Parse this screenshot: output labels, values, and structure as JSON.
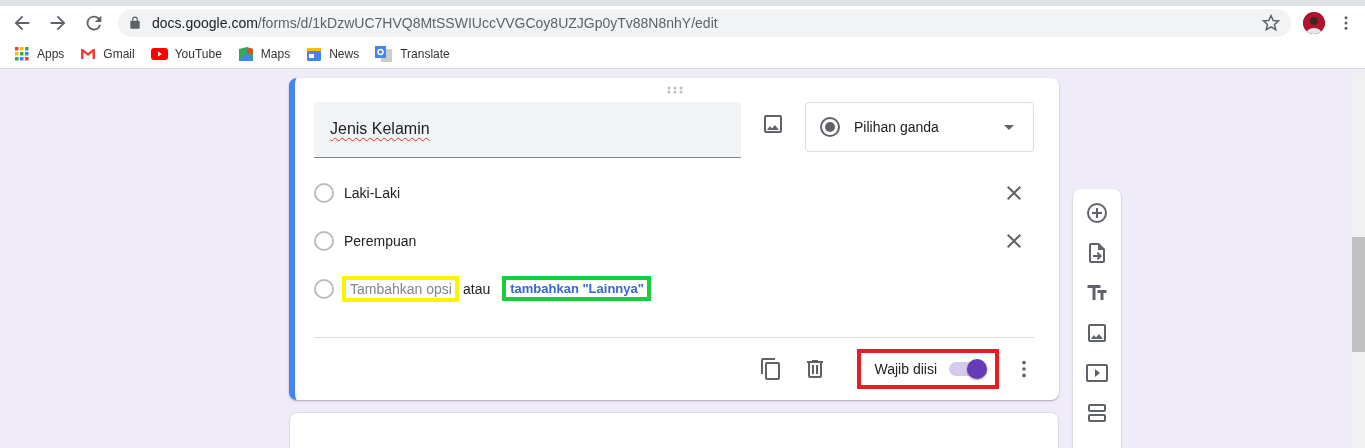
{
  "browser": {
    "url_host": "docs.google.com",
    "url_path": "/forms/d/1kDzwUC7HVQ8MtSSWIUccVVGCoy8UZJGp0yTv88N8nhY/edit",
    "bookmarks": [
      {
        "label": "Apps",
        "kind": "apps"
      },
      {
        "label": "Gmail",
        "kind": "gmail"
      },
      {
        "label": "YouTube",
        "kind": "youtube"
      },
      {
        "label": "Maps",
        "kind": "maps"
      },
      {
        "label": "News",
        "kind": "news"
      },
      {
        "label": "Translate",
        "kind": "translate"
      }
    ]
  },
  "question": {
    "title": "Jenis Kelamin",
    "type": "Pilihan ganda",
    "options": [
      {
        "label": "Laki-Laki",
        "selected": false
      },
      {
        "label": "Perempuan",
        "selected": false
      }
    ],
    "add_option": "Tambahkan opsi",
    "add_option_selected": false,
    "separator": "atau",
    "add_other": "tambahkan \"Lainnya\"",
    "required_label": "Wajib diisi",
    "required": true
  },
  "side_toolbar": [
    {
      "kind": "add"
    },
    {
      "kind": "import"
    },
    {
      "kind": "title"
    },
    {
      "kind": "image"
    },
    {
      "kind": "video"
    },
    {
      "kind": "section"
    }
  ]
}
